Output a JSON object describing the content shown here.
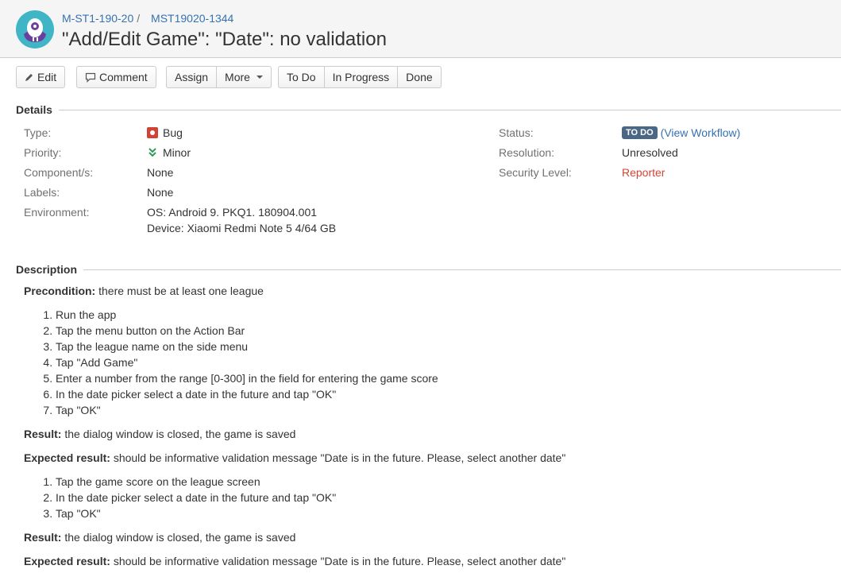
{
  "header": {
    "project_link": "M-ST1-190-20",
    "separator": "/",
    "issue_key": "MST19020-1344",
    "title": "\"Add/Edit Game\": \"Date\": no validation"
  },
  "toolbar": {
    "edit": "Edit",
    "comment": "Comment",
    "assign": "Assign",
    "more": "More",
    "todo": "To Do",
    "in_progress": "In Progress",
    "done": "Done"
  },
  "details": {
    "heading": "Details",
    "type_label": "Type:",
    "type_value": "Bug",
    "priority_label": "Priority:",
    "priority_value": "Minor",
    "components_label": "Component/s:",
    "components_value": "None",
    "labels_label": "Labels:",
    "labels_value": "None",
    "environment_label": "Environment:",
    "environment_line1": "OS: Android 9. PKQ1. 180904.001",
    "environment_line2": "Device: Xiaomi Redmi Note 5 4/64 GB",
    "status_label": "Status:",
    "status_value": "TO DO",
    "view_workflow_open": "(",
    "view_workflow": "View Workflow",
    "view_workflow_close": ")",
    "resolution_label": "Resolution:",
    "resolution_value": "Unresolved",
    "security_label": "Security Level:",
    "security_value": "Reporter"
  },
  "description": {
    "heading": "Description",
    "precondition_label": "Precondition:",
    "precondition_text": " there must be at least one league",
    "steps1": [
      "Run the app",
      "Tap the menu button on the Action Bar",
      "Tap the league name on the side menu",
      "Tap \"Add Game\"",
      "Enter a number from the range [0-300] in the field for entering the game score",
      "In the date picker select a date in the future and tap \"OK\"",
      "Tap \"OK\""
    ],
    "result1_label": "Result:",
    "result1_text": " the dialog window is closed, the game is saved",
    "expected1_label": "Expected result:",
    "expected1_text": " should be informative validation message \"Date is in the future. Please, select another date\"",
    "steps2": [
      "Tap the game score on the league screen",
      "In the date picker select a date in the future and tap \"OK\"",
      "Tap \"OK\""
    ],
    "result2_label": "Result:",
    "result2_text": " the dialog window is closed, the game is saved",
    "expected2_label": "Expected result:",
    "expected2_text": " should be informative validation message \"Date is in the future. Please, select another date\""
  },
  "colors": {
    "link": "#3572b0",
    "security": "#d04437",
    "lozenge": "#4a6785",
    "priority": "#2d9c5a"
  }
}
